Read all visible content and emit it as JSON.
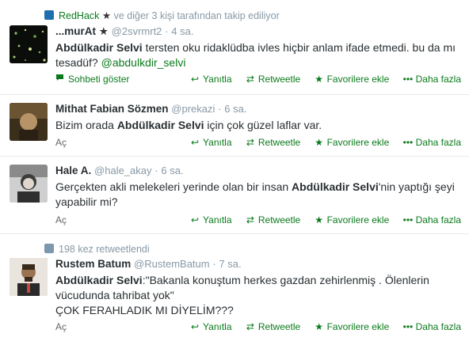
{
  "tweets": [
    {
      "context": {
        "icon": "person-follow-icon",
        "lead": "RedHack",
        "star": "★",
        "rest": "ve diğer 3 kişi tarafından takip ediliyor"
      },
      "fullname": "...murAt",
      "badge": "★",
      "username": "@2svrmrt2",
      "dot": "·",
      "time": "4 sa.",
      "text": {
        "bold": "Abdülkadir Selvi",
        "part1": " tersten oku ridaklüdba ivles hiçbir anlam ifade etmedi. bu da mı tesadüf? ",
        "mention": "@abdulkdir_selvi"
      },
      "expand": "Sohbeti göster"
    },
    {
      "fullname": "Mithat Fabian Sözmen",
      "username": "@prekazi",
      "dot": "·",
      "time": "6 sa.",
      "text": {
        "part0": "Bizim orada ",
        "bold": "Abdülkadir Selvi",
        "part1": " için çok güzel laflar var."
      },
      "expand": "Aç"
    },
    {
      "fullname": "Hale A.",
      "username": "@hale_akay",
      "dot": "·",
      "time": "6 sa.",
      "text": {
        "part0": "Gerçekten akli melekeleri yerinde olan bir insan ",
        "bold": "Abdülkadir Selvi",
        "part1": "'nin yaptığı şeyi yapabilir mi?"
      },
      "expand": "Aç"
    },
    {
      "context": {
        "icon": "retweet-icon",
        "lead": "",
        "rest": "198 kez retweetlendi"
      },
      "fullname": "Rustem Batum",
      "username": "@RustemBatum",
      "dot": "·",
      "time": "7 sa.",
      "text": {
        "bold": "Abdülkadir Selvi",
        "part1": ":\"Bakanla konuştum herkes gazdan zehirlenmiş . Ölenlerin vücudunda tahribat yok\"",
        "part2": "ÇOK FERAHLADIK MI DİYELİM???"
      },
      "expand": "Aç"
    }
  ],
  "actions": {
    "reply": "Yanıtla",
    "retweet": "Retweetle",
    "favorite": "Favorilere ekle",
    "more": "Daha fazla"
  },
  "colors": {
    "accent": "#0b7a1c",
    "meta": "#8899a6",
    "text": "#292f33",
    "divider": "#e8e8e8"
  }
}
